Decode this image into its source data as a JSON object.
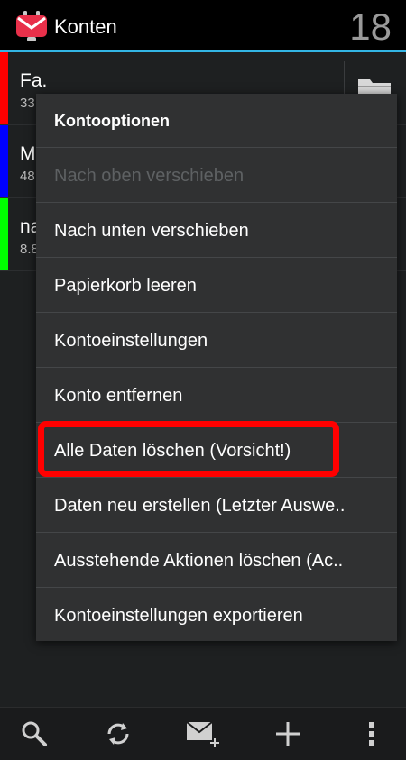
{
  "app": {
    "title": "Konten",
    "unread_count": "18"
  },
  "accounts": [
    {
      "name": "Fa.",
      "sub": "33",
      "color": "#ff0000"
    },
    {
      "name": "M",
      "sub": "48",
      "color": "#0000ff"
    },
    {
      "name": "na",
      "sub": "8.8",
      "color": "#00ff00"
    }
  ],
  "menu": {
    "header": "Kontooptionen",
    "items": [
      {
        "label": "Nach oben verschieben",
        "enabled": false
      },
      {
        "label": "Nach unten verschieben",
        "enabled": true
      },
      {
        "label": "Papierkorb leeren",
        "enabled": true
      },
      {
        "label": "Kontoeinstellungen",
        "enabled": true
      },
      {
        "label": "Konto entfernen",
        "enabled": true
      },
      {
        "label": "Alle Daten löschen (Vorsicht!)",
        "enabled": true
      },
      {
        "label": "Daten neu erstellen (Letzter Auswe..",
        "enabled": true
      },
      {
        "label": "Ausstehende Aktionen löschen (Ac..",
        "enabled": true
      },
      {
        "label": "Kontoeinstellungen exportieren",
        "enabled": true
      }
    ]
  },
  "bottom_bar": [
    "search-icon",
    "refresh-icon",
    "compose-icon",
    "add-icon",
    "overflow-icon"
  ],
  "colors": {
    "accent": "#33b5e5",
    "highlight": "#ff0000",
    "app_icon": "#e8304a"
  }
}
